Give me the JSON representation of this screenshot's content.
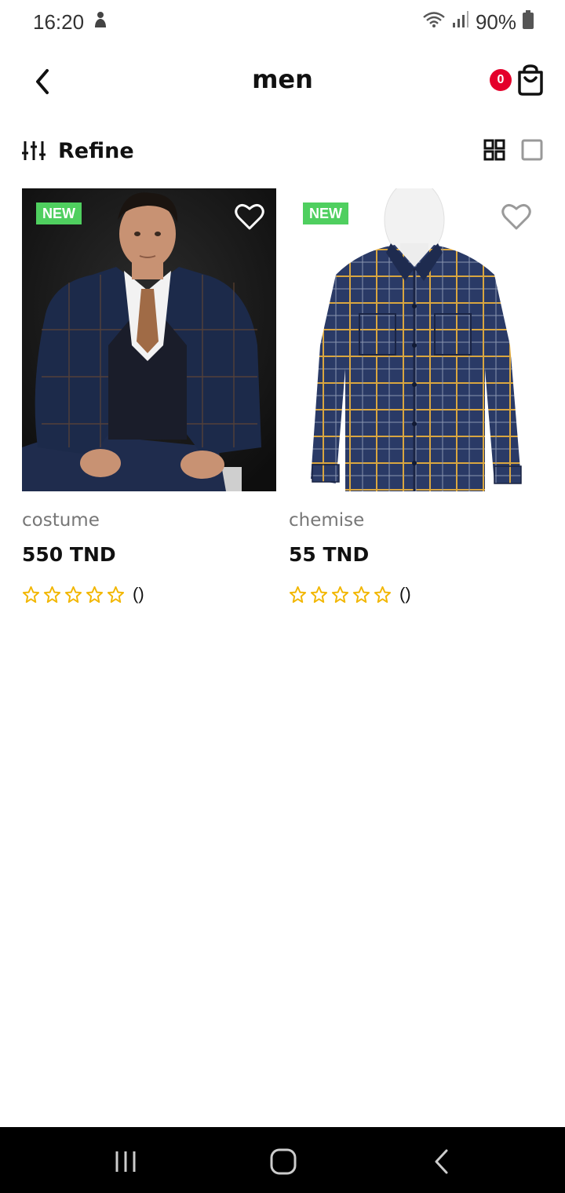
{
  "status_bar": {
    "time": "16:20",
    "battery": "90%"
  },
  "app_bar": {
    "title": "men",
    "cart_count": "0"
  },
  "toolbar": {
    "refine_label": "Refine"
  },
  "products": [
    {
      "badge": "NEW",
      "name": "costume",
      "price": "550 TND",
      "rating": 0,
      "rating_count": "()"
    },
    {
      "badge": "NEW",
      "name": "chemise",
      "price": "55 TND",
      "rating": 0,
      "rating_count": "()"
    }
  ],
  "colors": {
    "badge_new": "#4fcf5f",
    "cart_badge": "#e4002b",
    "star": "#f2b600",
    "shirt_navy": "#2a3a66",
    "shirt_check": "#d9a640"
  }
}
